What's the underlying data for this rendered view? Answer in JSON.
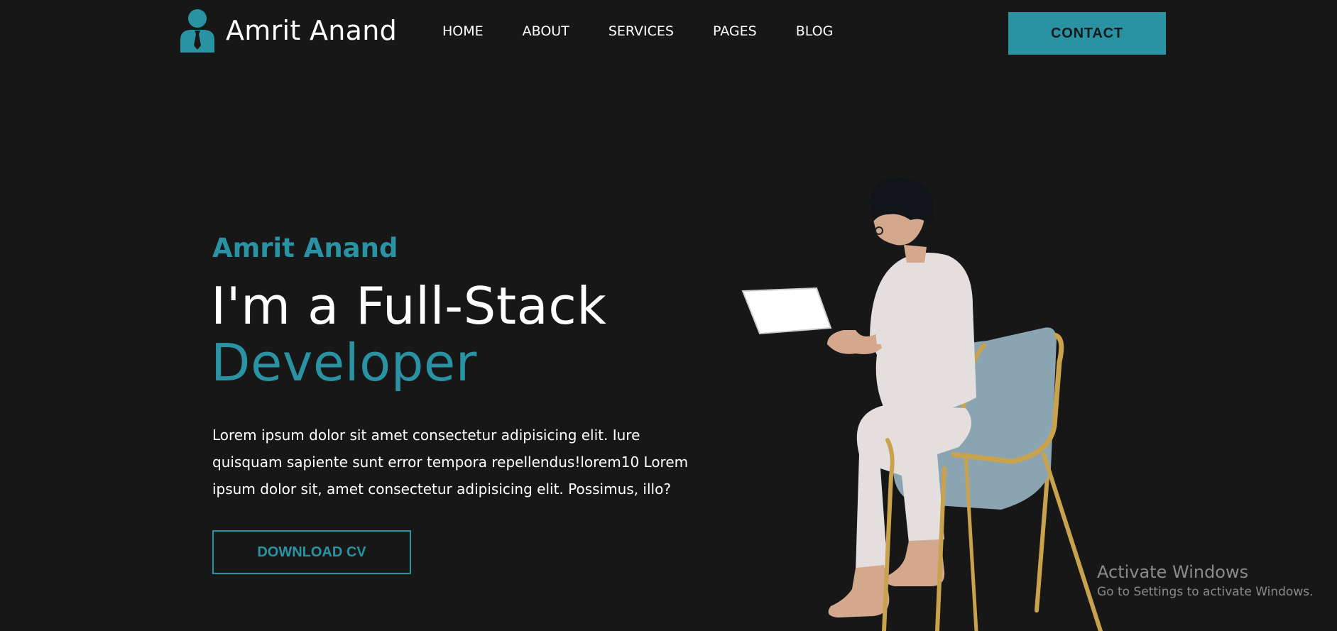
{
  "brand": {
    "name": "Amrit Anand",
    "icon": "user-tie-icon"
  },
  "nav": {
    "items": [
      "HOME",
      "ABOUT",
      "SERVICES",
      "PAGES",
      "BLOG"
    ]
  },
  "header": {
    "contact_label": "CONTACT"
  },
  "hero": {
    "name": "Amrit Anand",
    "headline_line1": "I'm a Full-Stack",
    "headline_line2": "Developer",
    "description": "Lorem ipsum dolor sit amet consectetur adipisicing elit. Iure quisquam sapiente sunt error tempora repellendus!lorem10 Lorem ipsum dolor sit, amet consectetur adipisicing elit. Possimus, illo?",
    "download_label": "DOWNLOAD CV",
    "illustration": "man-on-laptop-in-chair-illustration"
  },
  "watermark": {
    "title": "Activate Windows",
    "subtitle": "Go to Settings to activate Windows."
  },
  "colors": {
    "background": "#171717",
    "accent": "#2a93a3",
    "text": "#ffffff"
  }
}
